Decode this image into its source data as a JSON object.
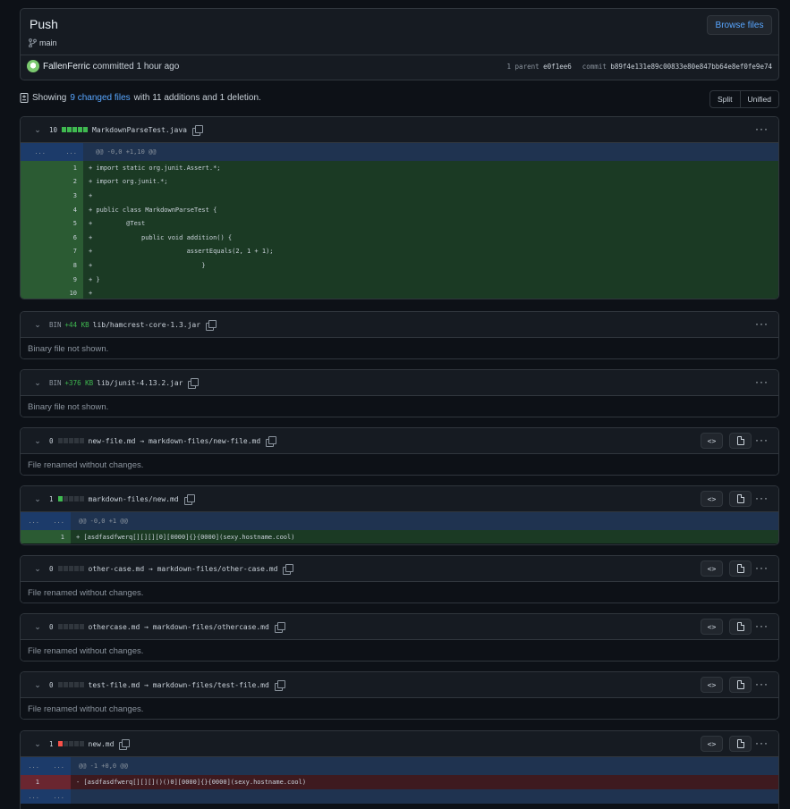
{
  "commit": {
    "title": "Push",
    "branch": "main",
    "browse_label": "Browse files",
    "author": "FallenFerric",
    "action": "committed 1 hour ago",
    "parent_label": "1 parent",
    "parent_sha": "e0f1ee6",
    "commit_label": "commit",
    "commit_sha": "b89f4e131e89c00833e80e847bb64e8ef0fe9e74"
  },
  "summary": {
    "showing": "Showing",
    "changed_files": "9 changed files",
    "rest": "with 11 additions and 1 deletion."
  },
  "view_toggle": {
    "split": "Split",
    "unified": "Unified"
  },
  "files": [
    {
      "count": "10",
      "name": "MarkdownParseTest.java",
      "hunk": "@@ -0,0 +1,10 @@",
      "lines": [
        {
          "n": "1",
          "text": "+ import static org.junit.Assert.*;"
        },
        {
          "n": "2",
          "text": "+ import org.junit.*;"
        },
        {
          "n": "3",
          "text": "+"
        },
        {
          "n": "4",
          "text": "+ public class MarkdownParseTest {"
        },
        {
          "n": "5",
          "text": "+         @Test"
        },
        {
          "n": "6",
          "text": "+             public void addition() {"
        },
        {
          "n": "7",
          "text": "+                         assertEquals(2, 1 + 1);"
        },
        {
          "n": "8",
          "text": "+                             }"
        },
        {
          "n": "9",
          "text": "+ }"
        },
        {
          "n": "10",
          "text": "+"
        }
      ]
    },
    {
      "bin": "BIN",
      "size": "+44 KB",
      "name": "lib/hamcrest-core-1.3.jar",
      "msg": "Binary file not shown."
    },
    {
      "bin": "BIN",
      "size": "+376 KB",
      "name": "lib/junit-4.13.2.jar",
      "msg": "Binary file not shown."
    },
    {
      "count": "0",
      "name": "new-file.md → markdown-files/new-file.md",
      "msg": "File renamed without changes."
    },
    {
      "count": "1",
      "name": "markdown-files/new.md",
      "hunk": "@@ -0,0 +1 @@",
      "line_n": "1",
      "line_text": "+ [asdfasdfwerq[][][][0][0000]{}{0000](sexy.hostname.cool)"
    },
    {
      "count": "0",
      "name": "other-case.md → markdown-files/other-case.md",
      "msg": "File renamed without changes."
    },
    {
      "count": "0",
      "name": "othercase.md → markdown-files/othercase.md",
      "msg": "File renamed without changes."
    },
    {
      "count": "0",
      "name": "test-file.md → markdown-files/test-file.md",
      "msg": "File renamed without changes."
    },
    {
      "count": "1",
      "name": "new.md",
      "hunk": "@@ -1 +0,0 @@",
      "line_n": "1",
      "line_text": "- [asdfasdfwerq[][][]()()0][0000]{}{0000](sexy.hostname.cool)"
    }
  ],
  "hunk_dots": "...",
  "icons": {
    "chevron": "chevron-down-icon",
    "copy": "copy-icon",
    "more": "kebab-horizontal-icon",
    "code": "code-icon",
    "file": "file-icon",
    "branch": "git-branch-icon",
    "diff": "file-diff-icon"
  },
  "colors": {
    "addition": "#3fb950",
    "deletion": "#f85149",
    "link": "#58a6ff"
  }
}
